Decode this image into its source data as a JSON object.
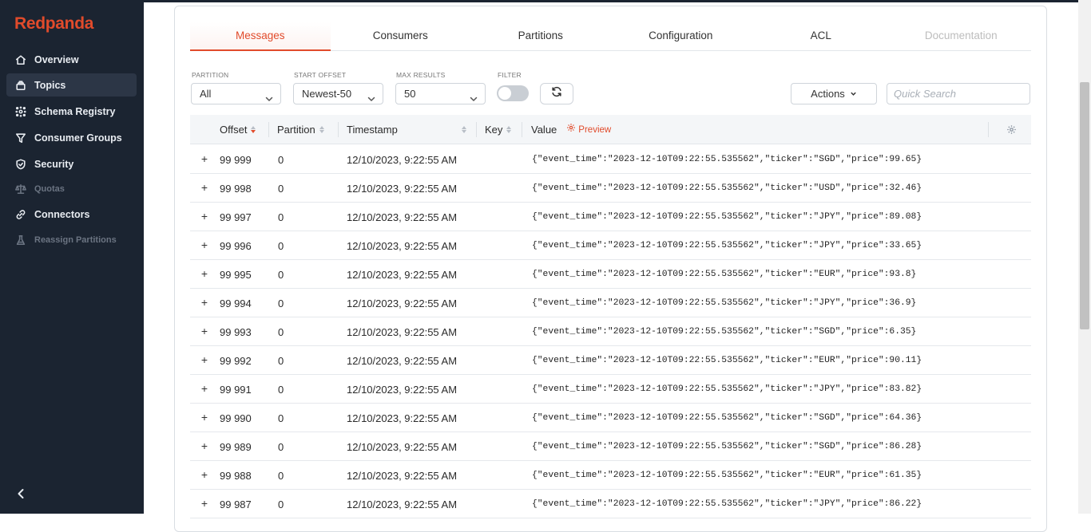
{
  "brand": "Redpanda",
  "sidebar": {
    "items": [
      {
        "label": "Overview",
        "icon": "home-icon"
      },
      {
        "label": "Topics",
        "icon": "topics-icon"
      },
      {
        "label": "Schema Registry",
        "icon": "schema-icon"
      },
      {
        "label": "Consumer Groups",
        "icon": "funnel-icon"
      },
      {
        "label": "Security",
        "icon": "shield-icon"
      },
      {
        "label": "Quotas",
        "icon": "scale-icon"
      },
      {
        "label": "Connectors",
        "icon": "link-icon"
      },
      {
        "label": "Reassign Partitions",
        "icon": "beaker-icon"
      }
    ]
  },
  "tabs": [
    "Messages",
    "Consumers",
    "Partitions",
    "Configuration",
    "ACL",
    "Documentation"
  ],
  "filters": {
    "partition": {
      "label": "PARTITION",
      "value": "All"
    },
    "start_offset": {
      "label": "START OFFSET",
      "value": "Newest-50"
    },
    "max_results": {
      "label": "MAX RESULTS",
      "value": "50"
    },
    "filter": {
      "label": "FILTER"
    },
    "actions_label": "Actions",
    "search_placeholder": "Quick Search"
  },
  "table": {
    "columns": {
      "offset": "Offset",
      "partition": "Partition",
      "timestamp": "Timestamp",
      "key": "Key",
      "value": "Value",
      "preview": "Preview"
    },
    "rows": [
      {
        "offset": "99 999",
        "partition": "0",
        "timestamp": "12/10/2023, 9:22:55 AM",
        "value": "{\"event_time\":\"2023-12-10T09:22:55.535562\",\"ticker\":\"SGD\",\"price\":99.65}"
      },
      {
        "offset": "99 998",
        "partition": "0",
        "timestamp": "12/10/2023, 9:22:55 AM",
        "value": "{\"event_time\":\"2023-12-10T09:22:55.535562\",\"ticker\":\"USD\",\"price\":32.46}"
      },
      {
        "offset": "99 997",
        "partition": "0",
        "timestamp": "12/10/2023, 9:22:55 AM",
        "value": "{\"event_time\":\"2023-12-10T09:22:55.535562\",\"ticker\":\"JPY\",\"price\":89.08}"
      },
      {
        "offset": "99 996",
        "partition": "0",
        "timestamp": "12/10/2023, 9:22:55 AM",
        "value": "{\"event_time\":\"2023-12-10T09:22:55.535562\",\"ticker\":\"JPY\",\"price\":33.65}"
      },
      {
        "offset": "99 995",
        "partition": "0",
        "timestamp": "12/10/2023, 9:22:55 AM",
        "value": "{\"event_time\":\"2023-12-10T09:22:55.535562\",\"ticker\":\"EUR\",\"price\":93.8}"
      },
      {
        "offset": "99 994",
        "partition": "0",
        "timestamp": "12/10/2023, 9:22:55 AM",
        "value": "{\"event_time\":\"2023-12-10T09:22:55.535562\",\"ticker\":\"JPY\",\"price\":36.9}"
      },
      {
        "offset": "99 993",
        "partition": "0",
        "timestamp": "12/10/2023, 9:22:55 AM",
        "value": "{\"event_time\":\"2023-12-10T09:22:55.535562\",\"ticker\":\"SGD\",\"price\":6.35}"
      },
      {
        "offset": "99 992",
        "partition": "0",
        "timestamp": "12/10/2023, 9:22:55 AM",
        "value": "{\"event_time\":\"2023-12-10T09:22:55.535562\",\"ticker\":\"EUR\",\"price\":90.11}"
      },
      {
        "offset": "99 991",
        "partition": "0",
        "timestamp": "12/10/2023, 9:22:55 AM",
        "value": "{\"event_time\":\"2023-12-10T09:22:55.535562\",\"ticker\":\"JPY\",\"price\":83.82}"
      },
      {
        "offset": "99 990",
        "partition": "0",
        "timestamp": "12/10/2023, 9:22:55 AM",
        "value": "{\"event_time\":\"2023-12-10T09:22:55.535562\",\"ticker\":\"SGD\",\"price\":64.36}"
      },
      {
        "offset": "99 989",
        "partition": "0",
        "timestamp": "12/10/2023, 9:22:55 AM",
        "value": "{\"event_time\":\"2023-12-10T09:22:55.535562\",\"ticker\":\"SGD\",\"price\":86.28}"
      },
      {
        "offset": "99 988",
        "partition": "0",
        "timestamp": "12/10/2023, 9:22:55 AM",
        "value": "{\"event_time\":\"2023-12-10T09:22:55.535562\",\"ticker\":\"EUR\",\"price\":61.35}"
      },
      {
        "offset": "99 987",
        "partition": "0",
        "timestamp": "12/10/2023, 9:22:55 AM",
        "value": "{\"event_time\":\"2023-12-10T09:22:55.535562\",\"ticker\":\"JPY\",\"price\":86.22}"
      }
    ]
  },
  "colors": {
    "accent": "#e14b2b",
    "sidebar_bg": "#1b2431",
    "sidebar_active": "#2c3646"
  }
}
